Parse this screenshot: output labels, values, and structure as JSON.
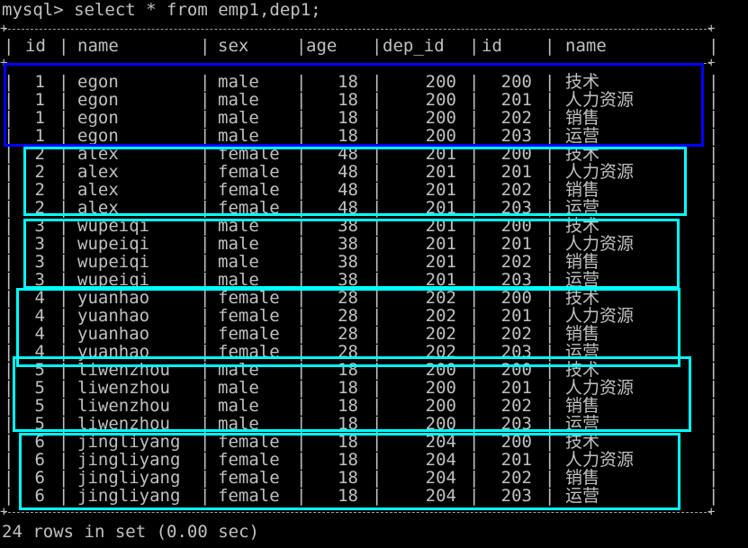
{
  "prompt": "mysql> select * from emp1,dep1;",
  "columns": [
    "id",
    "name",
    "sex",
    "age",
    "dep_id",
    "id",
    "name"
  ],
  "rows": [
    [
      "1",
      "egon",
      "male",
      "18",
      "200",
      "200",
      "技术"
    ],
    [
      "1",
      "egon",
      "male",
      "18",
      "200",
      "201",
      "人力资源"
    ],
    [
      "1",
      "egon",
      "male",
      "18",
      "200",
      "202",
      "销售"
    ],
    [
      "1",
      "egon",
      "male",
      "18",
      "200",
      "203",
      "运营"
    ],
    [
      "2",
      "alex",
      "female",
      "48",
      "201",
      "200",
      "技术"
    ],
    [
      "2",
      "alex",
      "female",
      "48",
      "201",
      "201",
      "人力资源"
    ],
    [
      "2",
      "alex",
      "female",
      "48",
      "201",
      "202",
      "销售"
    ],
    [
      "2",
      "alex",
      "female",
      "48",
      "201",
      "203",
      "运营"
    ],
    [
      "3",
      "wupeiqi",
      "male",
      "38",
      "201",
      "200",
      "技术"
    ],
    [
      "3",
      "wupeiqi",
      "male",
      "38",
      "201",
      "201",
      "人力资源"
    ],
    [
      "3",
      "wupeiqi",
      "male",
      "38",
      "201",
      "202",
      "销售"
    ],
    [
      "3",
      "wupeiqi",
      "male",
      "38",
      "201",
      "203",
      "运营"
    ],
    [
      "4",
      "yuanhao",
      "female",
      "28",
      "202",
      "200",
      "技术"
    ],
    [
      "4",
      "yuanhao",
      "female",
      "28",
      "202",
      "201",
      "人力资源"
    ],
    [
      "4",
      "yuanhao",
      "female",
      "28",
      "202",
      "202",
      "销售"
    ],
    [
      "4",
      "yuanhao",
      "female",
      "28",
      "202",
      "203",
      "运营"
    ],
    [
      "5",
      "liwenzhou",
      "male",
      "18",
      "200",
      "200",
      "技术"
    ],
    [
      "5",
      "liwenzhou",
      "male",
      "18",
      "200",
      "201",
      "人力资源"
    ],
    [
      "5",
      "liwenzhou",
      "male",
      "18",
      "200",
      "202",
      "销售"
    ],
    [
      "5",
      "liwenzhou",
      "male",
      "18",
      "200",
      "203",
      "运营"
    ],
    [
      "6",
      "jingliyang",
      "female",
      "18",
      "204",
      "200",
      "技术"
    ],
    [
      "6",
      "jingliyang",
      "female",
      "18",
      "204",
      "201",
      "人力资源"
    ],
    [
      "6",
      "jingliyang",
      "female",
      "18",
      "204",
      "202",
      "销售"
    ],
    [
      "6",
      "jingliyang",
      "female",
      "18",
      "204",
      "203",
      "运营"
    ]
  ],
  "footer": "24 rows in set (0.00 sec)",
  "colors": {
    "background": "#000000",
    "text": "#c0c0c0",
    "highlight_first": "#0000ff",
    "highlight_others": "#00ffff"
  }
}
